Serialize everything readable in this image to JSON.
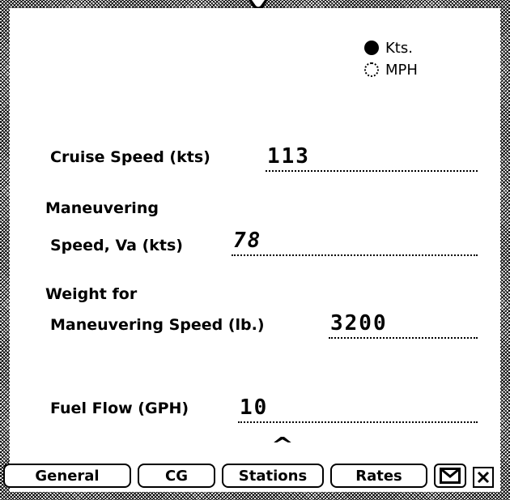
{
  "units": {
    "options": [
      {
        "label": "Kts.",
        "selected": true
      },
      {
        "label": "MPH",
        "selected": false
      }
    ]
  },
  "fields": {
    "cruise_speed": {
      "label": "Cruise Speed (kts)",
      "value": "113"
    },
    "maneuvering_speed": {
      "label_line1": "Maneuvering",
      "label_line2": "Speed, Va (kts)",
      "value": "78"
    },
    "weight": {
      "label_line1": "Weight for",
      "label_line2": "Maneuvering Speed (lb.)",
      "value": "3200"
    },
    "fuel_flow": {
      "label": "Fuel Flow (GPH)",
      "value": "10"
    }
  },
  "caret": "^",
  "tabs": {
    "general": "General",
    "cg": "CG",
    "stations": "Stations",
    "rates": "Rates"
  }
}
